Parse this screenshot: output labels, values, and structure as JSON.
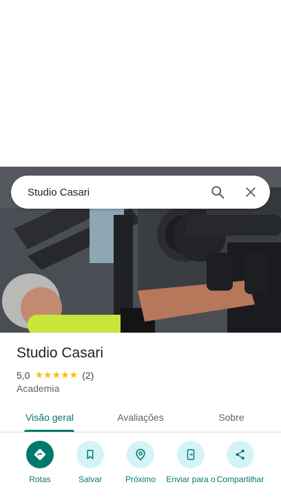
{
  "search": {
    "query": "Studio Casari"
  },
  "place": {
    "name": "Studio Casari",
    "rating": "5,0",
    "stars": "★★★★★",
    "review_count": "(2)",
    "category": "Academia"
  },
  "tabs": [
    {
      "label": "Visão geral",
      "active": true
    },
    {
      "label": "Avaliações",
      "active": false
    },
    {
      "label": "Sobre",
      "active": false
    }
  ],
  "actions": [
    {
      "label": "Rotas",
      "icon": "directions-icon"
    },
    {
      "label": "Salvar",
      "icon": "bookmark-icon"
    },
    {
      "label": "Próximo",
      "icon": "nearby-icon"
    },
    {
      "label": "Enviar para o",
      "icon": "send-to-phone-icon"
    },
    {
      "label": "Compartilhar",
      "icon": "share-icon"
    }
  ],
  "colors": {
    "accent": "#00796b",
    "accent_light": "#d4f3f7",
    "star": "#fbbc04"
  }
}
